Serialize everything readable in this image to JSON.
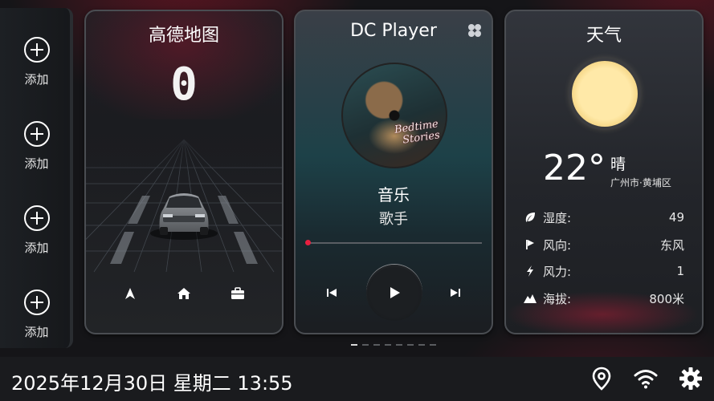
{
  "dock": {
    "items": [
      {
        "label": "添加",
        "icon": "plus-circle-icon"
      },
      {
        "label": "添加",
        "icon": "plus-circle-icon"
      },
      {
        "label": "添加",
        "icon": "plus-circle-icon"
      },
      {
        "label": "添加",
        "icon": "plus-circle-icon"
      }
    ]
  },
  "map_card": {
    "title": "高德地图",
    "speed": "0",
    "buttons": [
      "navigate-arrow-icon",
      "home-icon",
      "work-briefcase-icon"
    ]
  },
  "player_card": {
    "title": "DC Player",
    "album_text_line1": "Bedtime",
    "album_text_line2": "Stories",
    "song_title": "音乐",
    "artist": "歌手",
    "progress": 0.0,
    "accent": "#e81f3f"
  },
  "weather_card": {
    "title": "天气",
    "temperature": "22°",
    "condition": "晴",
    "location": "广州市·黄埔区",
    "rows": [
      {
        "icon": "leaf-icon",
        "label": "湿度:",
        "value": "49"
      },
      {
        "icon": "flag-icon",
        "label": "风向:",
        "value": "东风"
      },
      {
        "icon": "lightning-icon",
        "label": "风力:",
        "value": "1"
      },
      {
        "icon": "mountain-icon",
        "label": "海拔:",
        "value": "800米"
      }
    ]
  },
  "pager": {
    "count": 8,
    "active": 0
  },
  "statusbar": {
    "datetime": "2025年12月30日 星期二 13:55",
    "icons": [
      "location-pin-icon",
      "wifi-icon",
      "settings-gear-icon"
    ]
  }
}
